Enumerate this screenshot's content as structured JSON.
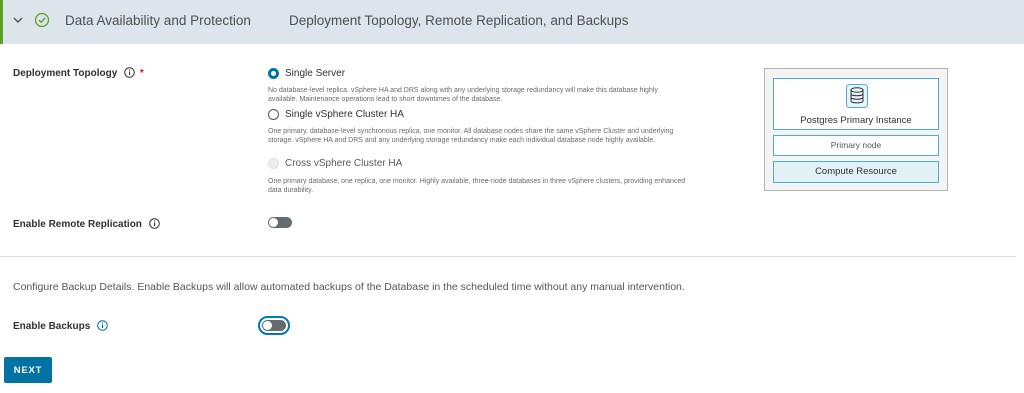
{
  "header": {
    "title": "Data Availability and Protection",
    "subtitle": "Deployment Topology, Remote Replication, and Backups",
    "status_icon": "check-circle-icon",
    "accent_color": "#5aa220"
  },
  "deployment_topology": {
    "label": "Deployment Topology",
    "required_mark": "*",
    "options": [
      {
        "label": "Single Server",
        "selected": true,
        "disabled": false,
        "description": "No database-level replica. vSphere HA and DRS along with any underlying storage redundancy will make this database highly available. Maintenance operations lead to short downtimes of the database."
      },
      {
        "label": "Single vSphere Cluster HA",
        "selected": false,
        "disabled": false,
        "description": "One primary, database-level synchronous replica, one monitor. All database nodes share the same vSphere Cluster and underlying storage. vSphere HA and DRS and any underlying storage redundancy make each individual database node highly available."
      },
      {
        "label": "Cross vSphere Cluster HA",
        "selected": false,
        "disabled": true,
        "description": "One primary database, one replica, one monitor. Highly available, three-node databases in three vSphere clusters, providing enhanced data durability."
      }
    ]
  },
  "diagram": {
    "instance_label": "Postgres Primary Instance",
    "node_label": "Primary node",
    "resource_label": "Compute Resource",
    "icon": "database-icon"
  },
  "remote_replication": {
    "label": "Enable Remote Replication",
    "enabled": false
  },
  "backups": {
    "intro": "Configure Backup Details. Enable Backups will allow automated backups of the Database in the scheduled time without any manual intervention.",
    "label": "Enable Backups",
    "enabled": false
  },
  "next_button": {
    "label": "NEXT"
  },
  "colors": {
    "primary": "#0072a3",
    "required": "#c92100",
    "info": "#0072a3"
  }
}
